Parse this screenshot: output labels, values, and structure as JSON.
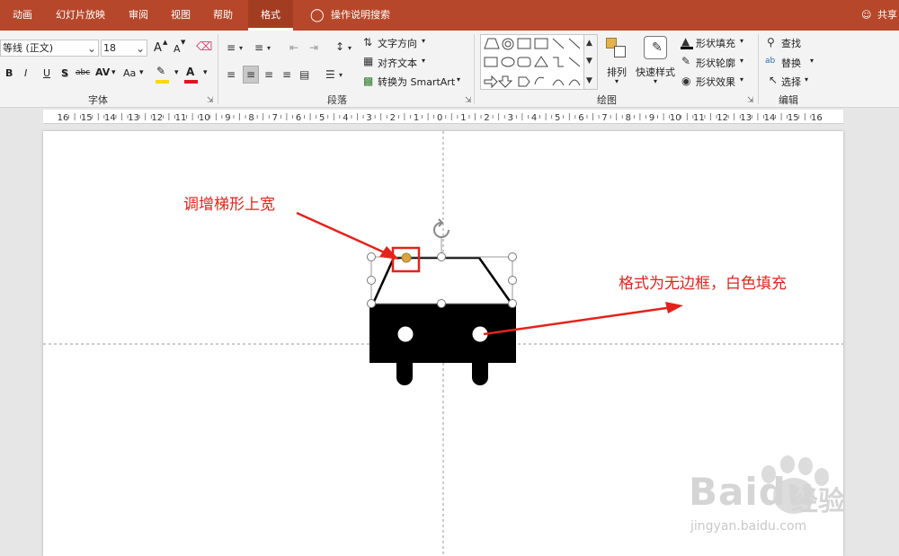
{
  "tabs": {
    "items": [
      "动画",
      "幻灯片放映",
      "审阅",
      "视图",
      "帮助",
      "格式"
    ],
    "tell_me": "操作说明搜索",
    "share": "共享"
  },
  "font": {
    "name": "等线 (正文)",
    "size": "18",
    "bold": "B",
    "italic": "I",
    "underline": "U",
    "shadow": "S",
    "strike": "abc",
    "spacing": "AV",
    "case": "Aa",
    "grow": "A",
    "shrink": "A",
    "color": "A",
    "group_label": "字体"
  },
  "paragraph": {
    "text_direction": "文字方向",
    "align_text": "对齐文本",
    "smartart": "转换为 SmartArt",
    "group_label": "段落"
  },
  "drawing": {
    "arrange": "排列",
    "quick_styles": "快速样式",
    "fill": "形状填充",
    "outline": "形状轮廓",
    "effects": "形状效果",
    "group_label": "绘图"
  },
  "editing": {
    "find": "查找",
    "replace": "替换",
    "select": "选择",
    "group_label": "编辑"
  },
  "ruler": {
    "ticks": [
      "16",
      "15",
      "14",
      "13",
      "12",
      "11",
      "10",
      "9",
      "8",
      "7",
      "6",
      "5",
      "4",
      "3",
      "2",
      "1",
      "0",
      "1",
      "2",
      "3",
      "4",
      "5",
      "6",
      "7",
      "8",
      "9",
      "10",
      "11",
      "12",
      "13",
      "14",
      "15",
      "16"
    ]
  },
  "annotations": {
    "trapezoid_tip": "调增梯形上宽",
    "format_tip": "格式为无边框，白色填充"
  },
  "watermark": {
    "brand": "Bai",
    "brand2": "du",
    "chinese": "经验",
    "url": "jingyan.baidu.com"
  },
  "colors": {
    "accent": "#b7472a",
    "annotation": "#e3231b",
    "highlight": "#ffd800",
    "font_color": "#e81123",
    "handle": "#d9a441"
  }
}
